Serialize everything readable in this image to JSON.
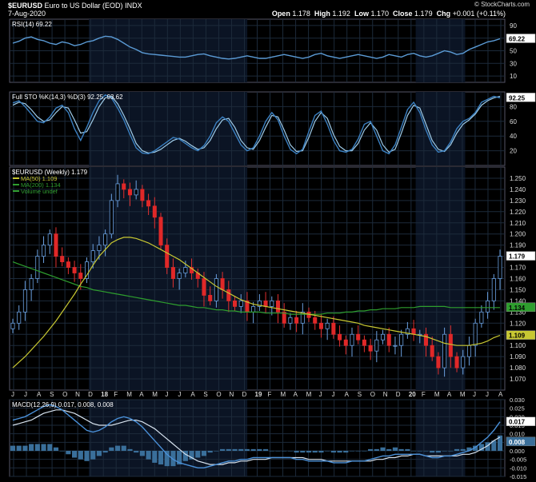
{
  "header": {
    "symbol": "$EURUSD",
    "name": "Euro to US Dollar (EOD)",
    "exchange": "INDX",
    "date": "7-Aug-2020",
    "brand": "© StockCharts.com",
    "quote": {
      "open_label": "Open",
      "open": "1.178",
      "high_label": "High",
      "high": "1.192",
      "low_label": "Low",
      "low": "1.170",
      "close_label": "Close",
      "close": "1.179",
      "chg_label": "Chg",
      "chg": "+0.001 (+0.11%)"
    }
  },
  "chart_data": [
    {
      "type": "line",
      "title": "RSI(14) 69.22",
      "ylim": [
        0,
        100
      ],
      "yticks": [
        "90",
        "70",
        "50",
        "30",
        "10"
      ],
      "last_label": "69.22",
      "series": [
        {
          "name": "RSI(14)",
          "values": [
            62,
            65,
            70,
            72,
            68,
            66,
            62,
            60,
            64,
            62,
            58,
            60,
            64,
            66,
            70,
            73,
            72,
            68,
            62,
            56,
            52,
            47,
            45,
            44,
            43,
            42,
            41,
            40,
            40,
            42,
            44,
            45,
            42,
            40,
            38,
            37,
            38,
            40,
            42,
            40,
            38,
            38,
            40,
            42,
            44,
            42,
            40,
            38,
            40,
            44,
            46,
            42,
            40,
            38,
            40,
            42,
            44,
            42,
            40,
            38,
            40,
            44,
            42,
            40,
            44,
            46,
            42,
            40,
            42,
            46,
            50,
            48,
            44,
            46,
            52,
            56,
            60,
            64,
            66,
            69
          ]
        }
      ]
    },
    {
      "type": "line",
      "title": "Full STO %K(14,3) %D(3) 92.25, 93.62",
      "ylim": [
        0,
        100
      ],
      "yticks": [
        "80",
        "60",
        "40",
        "20"
      ],
      "last_label": "92.25",
      "series": [
        {
          "name": "%K(14,3)",
          "values": [
            85,
            88,
            80,
            70,
            60,
            58,
            66,
            78,
            82,
            72,
            50,
            34,
            52,
            72,
            88,
            96,
            92,
            78,
            62,
            42,
            24,
            17,
            16,
            20,
            26,
            32,
            38,
            36,
            30,
            24,
            20,
            27,
            40,
            58,
            66,
            60,
            44,
            28,
            20,
            24,
            40,
            60,
            72,
            62,
            40,
            22,
            16,
            22,
            46,
            68,
            74,
            56,
            34,
            20,
            18,
            22,
            36,
            56,
            60,
            40,
            20,
            16,
            28,
            52,
            76,
            86,
            72,
            48,
            28,
            18,
            20,
            32,
            50,
            60,
            64,
            72,
            86,
            90,
            94,
            92
          ]
        },
        {
          "name": "%D(3)",
          "values": [
            82,
            86,
            84,
            76,
            66,
            60,
            62,
            72,
            80,
            78,
            62,
            44,
            46,
            62,
            80,
            92,
            94,
            84,
            68,
            50,
            30,
            20,
            17,
            18,
            22,
            28,
            34,
            37,
            33,
            27,
            22,
            24,
            34,
            50,
            62,
            64,
            52,
            34,
            24,
            22,
            34,
            52,
            68,
            66,
            48,
            28,
            19,
            20,
            38,
            60,
            72,
            64,
            42,
            26,
            20,
            20,
            30,
            48,
            58,
            48,
            28,
            18,
            22,
            44,
            68,
            82,
            78,
            56,
            34,
            22,
            19,
            28,
            44,
            56,
            62,
            70,
            82,
            88,
            92,
            94
          ]
        }
      ]
    },
    {
      "type": "candlestick",
      "title": "$EURUSD (Weekly) 1.179",
      "ylim": [
        1.06,
        1.26
      ],
      "yticks": [
        "1.250",
        "1.240",
        "1.230",
        "1.220",
        "1.210",
        "1.200",
        "1.190",
        "1.180",
        "1.170",
        "1.160",
        "1.150",
        "1.140",
        "1.130",
        "1.120",
        "1.110",
        "1.100",
        "1.090",
        "1.080",
        "1.070"
      ],
      "xticks": [
        "J",
        "J",
        "A",
        "S",
        "O",
        "N",
        "D",
        "18",
        "F",
        "M",
        "A",
        "M",
        "J",
        "J",
        "A",
        "S",
        "O",
        "N",
        "D",
        "19",
        "F",
        "M",
        "A",
        "M",
        "J",
        "J",
        "A",
        "S",
        "O",
        "N",
        "D",
        "20",
        "F",
        "M",
        "A",
        "M",
        "J",
        "J",
        "A"
      ],
      "legend": [
        {
          "label": "MA(50) 1.109",
          "color": "#c8c832"
        },
        {
          "label": "MA(200) 1.134",
          "color": "#2e9e2e"
        },
        {
          "label": "Volume undef",
          "color": "#32a032"
        }
      ],
      "price_label": "1.179",
      "ma50_label": "1.109",
      "ma200_label": "1.134",
      "close": [
        1.12,
        1.13,
        1.15,
        1.16,
        1.18,
        1.19,
        1.2,
        1.18,
        1.175,
        1.17,
        1.165,
        1.16,
        1.175,
        1.185,
        1.19,
        1.2,
        1.23,
        1.245,
        1.24,
        1.235,
        1.24,
        1.23,
        1.225,
        1.215,
        1.19,
        1.17,
        1.16,
        1.165,
        1.17,
        1.165,
        1.16,
        1.145,
        1.14,
        1.16,
        1.15,
        1.14,
        1.135,
        1.14,
        1.13,
        1.135,
        1.14,
        1.135,
        1.14,
        1.13,
        1.12,
        1.125,
        1.12,
        1.13,
        1.125,
        1.12,
        1.115,
        1.12,
        1.11,
        1.105,
        1.1,
        1.11,
        1.105,
        1.1,
        1.095,
        1.105,
        1.11,
        1.1,
        1.1,
        1.11,
        1.115,
        1.11,
        1.11,
        1.1,
        1.09,
        1.08,
        1.11,
        1.09,
        1.08,
        1.09,
        1.1,
        1.12,
        1.13,
        1.14,
        1.16,
        1.18
      ],
      "ma50": [
        1.08,
        1.085,
        1.09,
        1.096,
        1.102,
        1.108,
        1.115,
        1.122,
        1.13,
        1.138,
        1.146,
        1.155,
        1.163,
        1.172,
        1.18,
        1.186,
        1.192,
        1.195,
        1.197,
        1.197,
        1.196,
        1.194,
        1.192,
        1.189,
        1.186,
        1.183,
        1.18,
        1.177,
        1.173,
        1.169,
        1.165,
        1.161,
        1.157,
        1.153,
        1.15,
        1.147,
        1.144,
        1.141,
        1.139,
        1.137,
        1.136,
        1.135,
        1.134,
        1.133,
        1.132,
        1.131,
        1.13,
        1.129,
        1.128,
        1.127,
        1.126,
        1.125,
        1.124,
        1.123,
        1.122,
        1.121,
        1.12,
        1.118,
        1.117,
        1.116,
        1.115,
        1.114,
        1.113,
        1.112,
        1.111,
        1.11,
        1.109,
        1.108,
        1.106,
        1.104,
        1.102,
        1.101,
        1.1,
        1.1,
        1.1,
        1.101,
        1.102,
        1.104,
        1.107,
        1.109
      ],
      "ma200": [
        1.175,
        1.173,
        1.171,
        1.169,
        1.167,
        1.165,
        1.163,
        1.161,
        1.159,
        1.157,
        1.155,
        1.153,
        1.152,
        1.15,
        1.149,
        1.148,
        1.147,
        1.146,
        1.145,
        1.144,
        1.143,
        1.142,
        1.141,
        1.14,
        1.139,
        1.138,
        1.137,
        1.136,
        1.136,
        1.135,
        1.134,
        1.134,
        1.133,
        1.132,
        1.132,
        1.131,
        1.131,
        1.13,
        1.13,
        1.13,
        1.13,
        1.129,
        1.129,
        1.129,
        1.129,
        1.128,
        1.128,
        1.128,
        1.128,
        1.128,
        1.128,
        1.129,
        1.129,
        1.129,
        1.13,
        1.13,
        1.131,
        1.131,
        1.132,
        1.132,
        1.133,
        1.133,
        1.133,
        1.134,
        1.134,
        1.134,
        1.135,
        1.135,
        1.135,
        1.135,
        1.135,
        1.134,
        1.134,
        1.134,
        1.134,
        1.134,
        1.134,
        1.134,
        1.134,
        1.134
      ]
    },
    {
      "type": "line",
      "title": "MACD(12,26,9) 0.017, 0.008, 0.008",
      "ylim": [
        -0.015,
        0.03
      ],
      "yticks": [
        "0.030",
        "0.025",
        "0.020",
        "0.015",
        "0.010",
        "0.005",
        "0.000",
        "-0.005",
        "-0.010",
        "-0.015"
      ],
      "last_label": "0.017",
      "hist_label": "0.008",
      "series": [
        {
          "name": "MACD",
          "values": [
            0.018,
            0.019,
            0.02,
            0.022,
            0.024,
            0.026,
            0.027,
            0.026,
            0.024,
            0.021,
            0.018,
            0.015,
            0.012,
            0.011,
            0.012,
            0.014,
            0.017,
            0.019,
            0.02,
            0.019,
            0.017,
            0.014,
            0.01,
            0.006,
            0.002,
            -0.002,
            -0.005,
            -0.007,
            -0.008,
            -0.009,
            -0.01,
            -0.01,
            -0.009,
            -0.008,
            -0.007,
            -0.006,
            -0.006,
            -0.005,
            -0.005,
            -0.004,
            -0.004,
            -0.004,
            -0.004,
            -0.004,
            -0.004,
            -0.004,
            -0.005,
            -0.005,
            -0.006,
            -0.006,
            -0.006,
            -0.006,
            -0.007,
            -0.007,
            -0.007,
            -0.006,
            -0.006,
            -0.006,
            -0.005,
            -0.004,
            -0.003,
            -0.003,
            -0.002,
            -0.002,
            -0.002,
            -0.002,
            -0.002,
            -0.003,
            -0.004,
            -0.004,
            -0.003,
            -0.003,
            -0.002,
            -0.001,
            0.0,
            0.002,
            0.005,
            0.008,
            0.012,
            0.017
          ]
        },
        {
          "name": "Signal",
          "values": [
            0.015,
            0.016,
            0.017,
            0.018,
            0.02,
            0.022,
            0.023,
            0.024,
            0.024,
            0.023,
            0.022,
            0.02,
            0.018,
            0.016,
            0.015,
            0.015,
            0.015,
            0.016,
            0.017,
            0.018,
            0.018,
            0.017,
            0.015,
            0.013,
            0.01,
            0.007,
            0.004,
            0.001,
            -0.002,
            -0.004,
            -0.006,
            -0.007,
            -0.008,
            -0.008,
            -0.008,
            -0.007,
            -0.007,
            -0.006,
            -0.006,
            -0.005,
            -0.005,
            -0.005,
            -0.004,
            -0.004,
            -0.004,
            -0.004,
            -0.004,
            -0.004,
            -0.005,
            -0.005,
            -0.005,
            -0.006,
            -0.006,
            -0.006,
            -0.006,
            -0.006,
            -0.006,
            -0.006,
            -0.006,
            -0.005,
            -0.005,
            -0.004,
            -0.004,
            -0.003,
            -0.003,
            -0.002,
            -0.002,
            -0.003,
            -0.003,
            -0.003,
            -0.003,
            -0.003,
            -0.003,
            -0.002,
            -0.002,
            -0.001,
            0.001,
            0.003,
            0.006,
            0.008
          ]
        }
      ]
    }
  ]
}
